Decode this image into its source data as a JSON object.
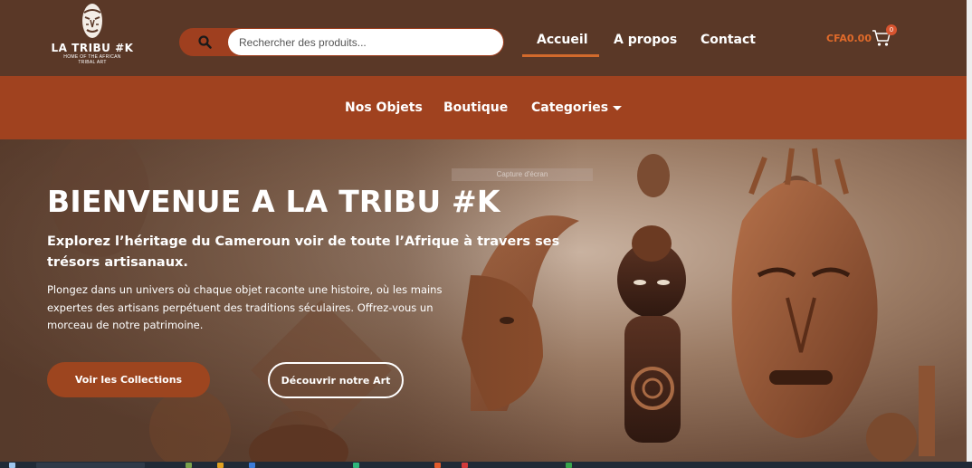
{
  "header": {
    "logo": {
      "brand": "LA TRIBU #K",
      "tagline_line1": "HOME OF THE AFRICAN",
      "tagline_line2": "TRIBAL ART"
    },
    "search": {
      "placeholder": "Rechercher des produits..."
    },
    "nav": [
      {
        "label": "Accueil",
        "active": true
      },
      {
        "label": "A propos",
        "active": false
      },
      {
        "label": "Contact",
        "active": false
      }
    ],
    "cart": {
      "amount": "CFA0.00",
      "count": "0"
    }
  },
  "subnav": {
    "items": [
      {
        "label": "Nos Objets"
      },
      {
        "label": "Boutique"
      },
      {
        "label": "Categories"
      }
    ]
  },
  "hero": {
    "overlay_label": "Capture d'écran",
    "title": "BIENVENUE A LA TRIBU #K",
    "subtitle": "Explorez l’héritage du Cameroun voir de toute l’Afrique à travers ses trésors artisanaux.",
    "text": "Plongez dans un univers où chaque objet raconte une histoire, où les mains expertes des artisans perpétuent des traditions séculaires. Offrez-vous un morceau de notre patrimoine.",
    "primary_button": "Voir les Collections",
    "secondary_button": "Découvrir notre Art"
  },
  "colors": {
    "header_bg": "#5a3827",
    "subnav_bg": "#a0421f",
    "accent": "#d26a2c",
    "button_bg": "#9d451f"
  }
}
